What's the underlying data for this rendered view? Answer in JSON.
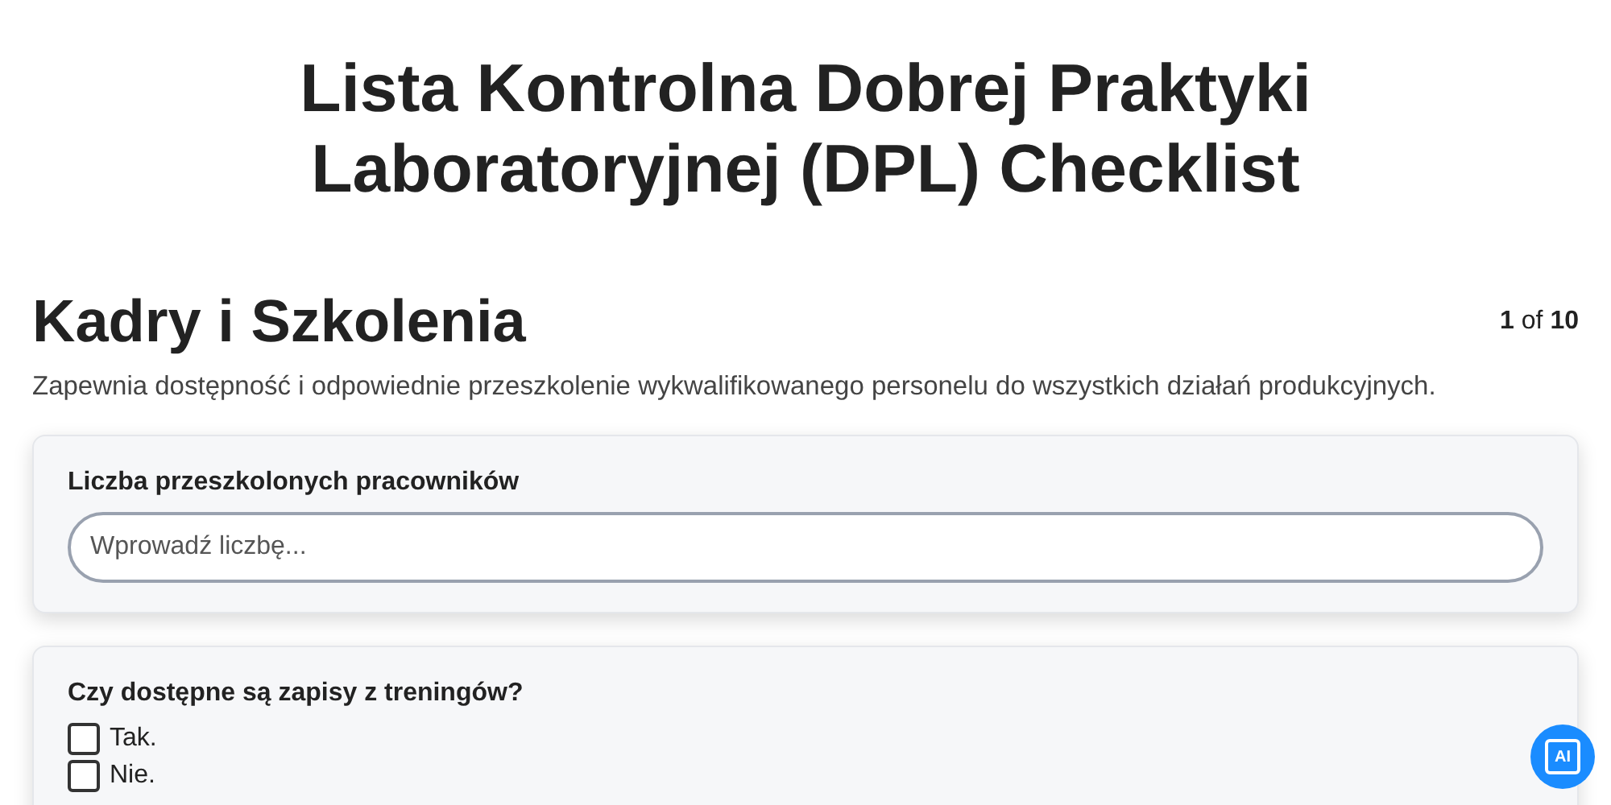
{
  "title": "Lista Kontrolna Dobrej Praktyki Laboratoryjnej (DPL) Checklist",
  "section": {
    "heading": "Kadry i Szkolenia",
    "page_current": "1",
    "page_of": "of",
    "page_total": "10",
    "description": "Zapewnia dostępność i odpowiednie przeszkolenie wykwalifikowanego personelu do wszystkich działań produkcyjnych."
  },
  "questions": [
    {
      "kind": "number",
      "label": "Liczba przeszkolonych pracowników",
      "placeholder": "Wprowadź liczbę..."
    },
    {
      "kind": "checkboxes",
      "label": "Czy dostępne są zapisy z treningów?",
      "options": [
        {
          "label": "Tak.",
          "checked": false
        },
        {
          "label": "Nie.",
          "checked": false
        }
      ]
    }
  ],
  "ai_button": {
    "label": "AI"
  }
}
